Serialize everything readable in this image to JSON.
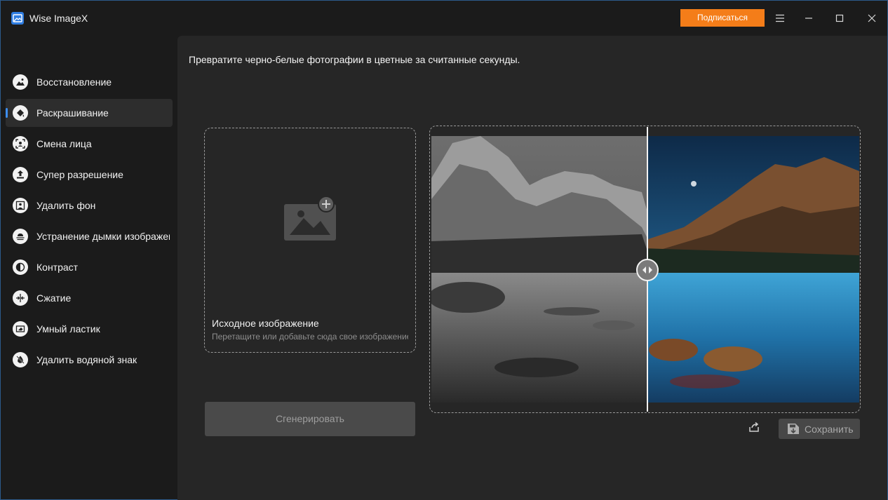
{
  "app": {
    "title": "Wise ImageX"
  },
  "titlebar": {
    "subscribe_label": "Подписаться",
    "accent_color": "#f47d19"
  },
  "sidebar": {
    "items": [
      {
        "label": "Восстановление",
        "icon": "mountain-image-icon",
        "active": false
      },
      {
        "label": "Раскрашивание",
        "icon": "paint-bucket-icon",
        "active": true
      },
      {
        "label": "Смена лица",
        "icon": "face-scan-icon",
        "active": false
      },
      {
        "label": "Супер разрешение",
        "icon": "upscale-icon",
        "active": false
      },
      {
        "label": "Удалить фон",
        "icon": "person-cutout-icon",
        "active": false
      },
      {
        "label": "Устранение дымки изображения",
        "icon": "dehaze-icon",
        "active": false
      },
      {
        "label": "Контраст",
        "icon": "contrast-icon",
        "active": false
      },
      {
        "label": "Сжатие",
        "icon": "compress-icon",
        "active": false
      },
      {
        "label": "Умный ластик",
        "icon": "eraser-icon",
        "active": false
      },
      {
        "label": "Удалить водяной знак",
        "icon": "watermark-remove-icon",
        "active": false
      }
    ],
    "active_color": "#3d8ef0"
  },
  "main": {
    "headline": "Превратите черно-белые фотографии в цветные за считанные секунды.",
    "dropzone": {
      "title": "Исходное изображение",
      "hint": "Перетащите или добавьте сюда свое изображение"
    },
    "generate_label": "Сгенерировать",
    "save_label": "Сохранить"
  }
}
